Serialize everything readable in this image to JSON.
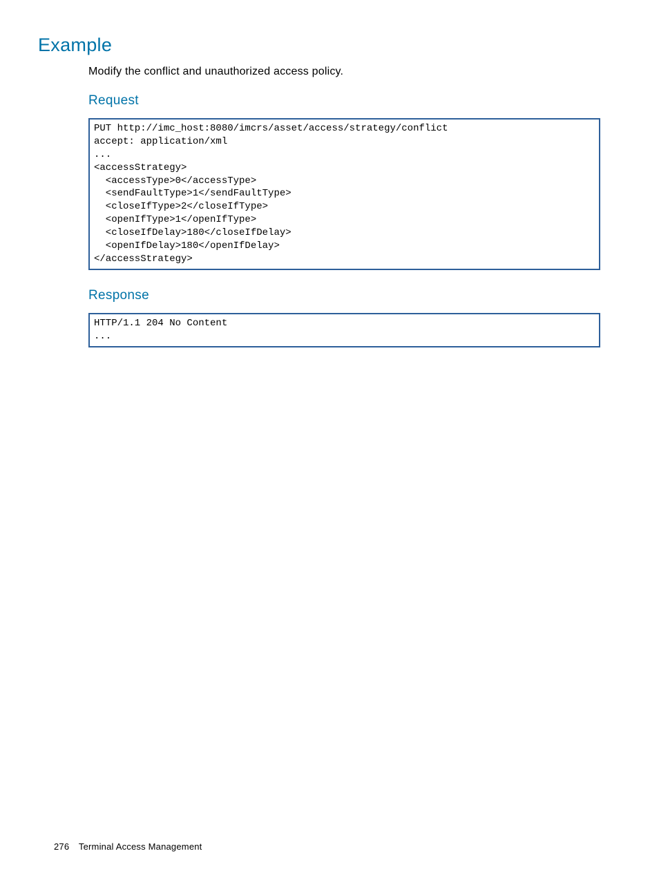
{
  "headings": {
    "example": "Example",
    "request": "Request",
    "response": "Response"
  },
  "body": {
    "intro": "Modify the conflict and unauthorized access policy."
  },
  "code": {
    "request": "PUT http://imc_host:8080/imcrs/asset/access/strategy/conflict\naccept: application/xml\n...\n<accessStrategy>\n  <accessType>0</accessType>\n  <sendFaultType>1</sendFaultType>\n  <closeIfType>2</closeIfType>\n  <openIfType>1</openIfType>\n  <closeIfDelay>180</closeIfDelay>\n  <openIfDelay>180</openIfDelay>\n</accessStrategy>",
    "response": "HTTP/1.1 204 No Content\n..."
  },
  "footer": {
    "page_number": "276",
    "section": "Terminal Access Management"
  }
}
